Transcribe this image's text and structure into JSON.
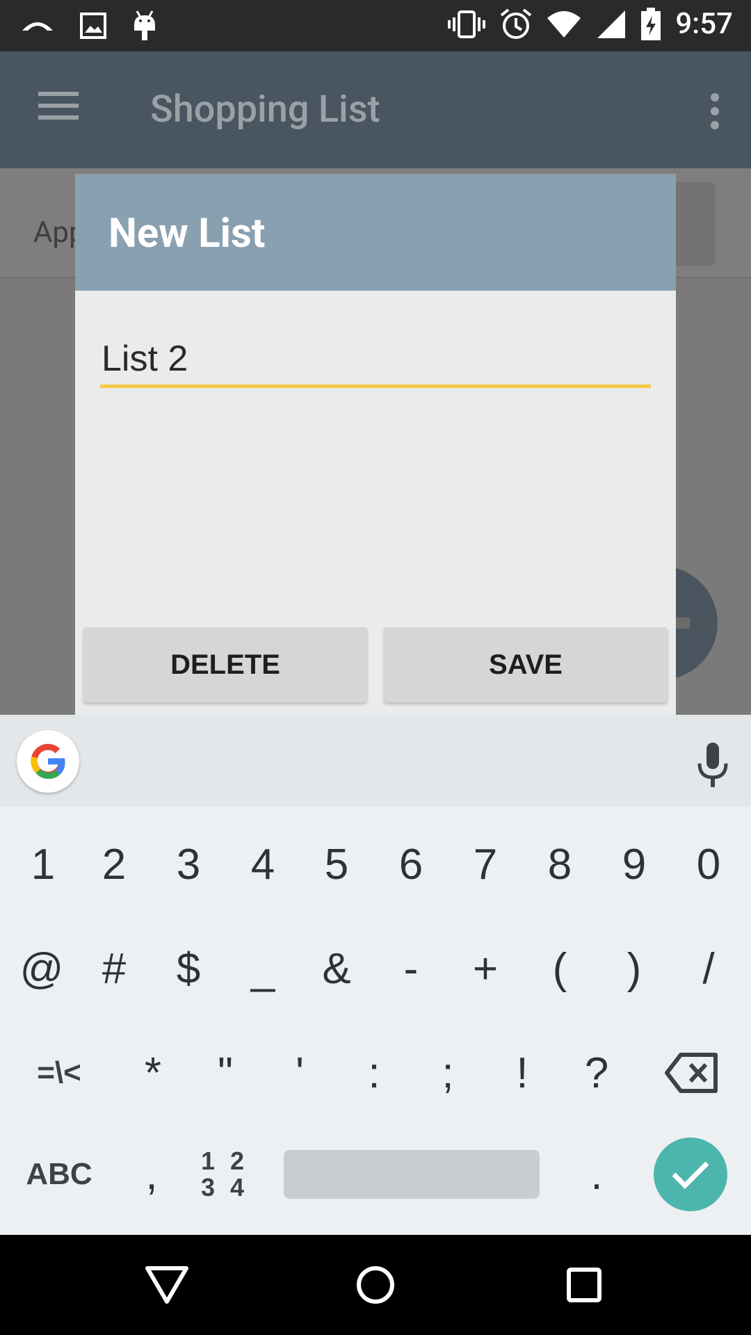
{
  "status_bar": {
    "time": "9:57",
    "left_icons": [
      "cast-icon",
      "image-icon",
      "android-icon"
    ],
    "right_icons": [
      "vibrate-icon",
      "alarm-icon",
      "wifi-icon",
      "signal-icon",
      "battery-charging-icon"
    ]
  },
  "app": {
    "toolbar_title": "Shopping List",
    "row_text": "App"
  },
  "dialog": {
    "title": "New List",
    "input_value": "List 2",
    "delete_label": "DELETE",
    "save_label": "SAVE",
    "accent_color": "#f7c844",
    "header_color": "#89a0b1"
  },
  "keyboard": {
    "row1": [
      "1",
      "2",
      "3",
      "4",
      "5",
      "6",
      "7",
      "8",
      "9",
      "0"
    ],
    "row2": [
      "@",
      "#",
      "$",
      "_",
      "&",
      "-",
      "+",
      "(",
      ")",
      "/"
    ],
    "row3": [
      "=\\<",
      "*",
      "\"",
      "'",
      ":",
      ";",
      "!",
      "?"
    ],
    "abc": "ABC",
    "comma": ",",
    "num_switch_top": "1 2",
    "num_switch_bottom": "3 4",
    "period": ".",
    "enter_color": "#4db6ac"
  },
  "nav_bar": {
    "icons": [
      "back-icon",
      "home-icon",
      "recents-icon"
    ]
  }
}
